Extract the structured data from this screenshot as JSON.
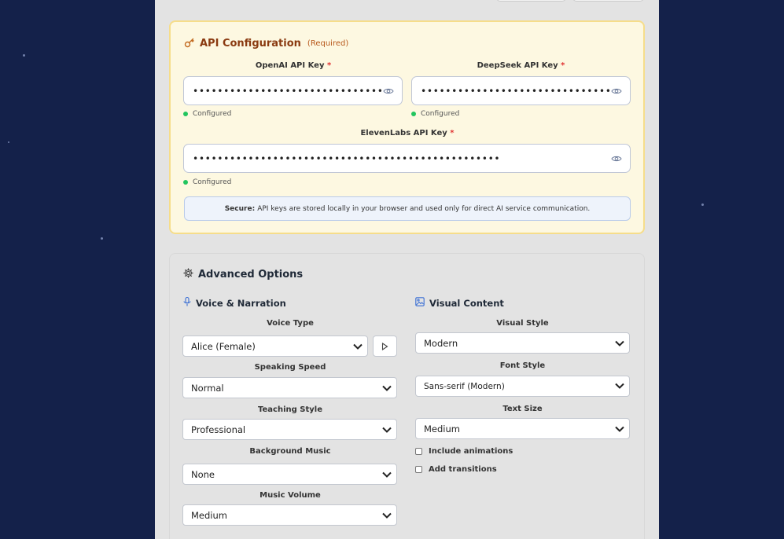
{
  "api_config": {
    "title": "API Configuration",
    "required_label": "(Required)",
    "required_marker": "*",
    "openai": {
      "label": "OpenAI API Key",
      "value": "••••••••••••••••••••••••••••••••••••",
      "status": "Configured"
    },
    "deepseek": {
      "label": "DeepSeek API Key",
      "value": "•••••••••••••••••••••••••••••••••••",
      "status": "Configured"
    },
    "elevenlabs": {
      "label": "ElevenLabs API Key",
      "value": "••••••••••••••••••••••••••••••••••••••••••••••••••",
      "status": "Configured"
    },
    "secure_bold": "Secure:",
    "secure_text": "API keys are stored locally in your browser and used only for direct AI service communication."
  },
  "advanced": {
    "title": "Advanced Options",
    "voice": {
      "title": "Voice & Narration",
      "voice_type_label": "Voice Type",
      "voice_type_value": "Alice (Female)",
      "speed_label": "Speaking Speed",
      "speed_value": "Normal",
      "teaching_label": "Teaching Style",
      "teaching_value": "Professional",
      "music_label": "Background Music",
      "music_value": "None",
      "volume_label": "Music Volume",
      "volume_value": "Medium"
    },
    "visual": {
      "title": "Visual Content",
      "style_label": "Visual Style",
      "style_value": "Modern",
      "font_label": "Font Style",
      "font_value": "Sans-serif (Modern)",
      "size_label": "Text Size",
      "size_value": "Medium",
      "animations_label": "Include animations",
      "transitions_label": "Add transitions",
      "animations_checked": false,
      "transitions_checked": false
    }
  },
  "colors": {
    "background": "#14214a",
    "api_card_bg": "#fdf8e1",
    "api_card_border": "#f6dd8a",
    "status_green": "#22c55e",
    "required_red": "#e03131",
    "accent_blue": "#3b6fd4"
  }
}
